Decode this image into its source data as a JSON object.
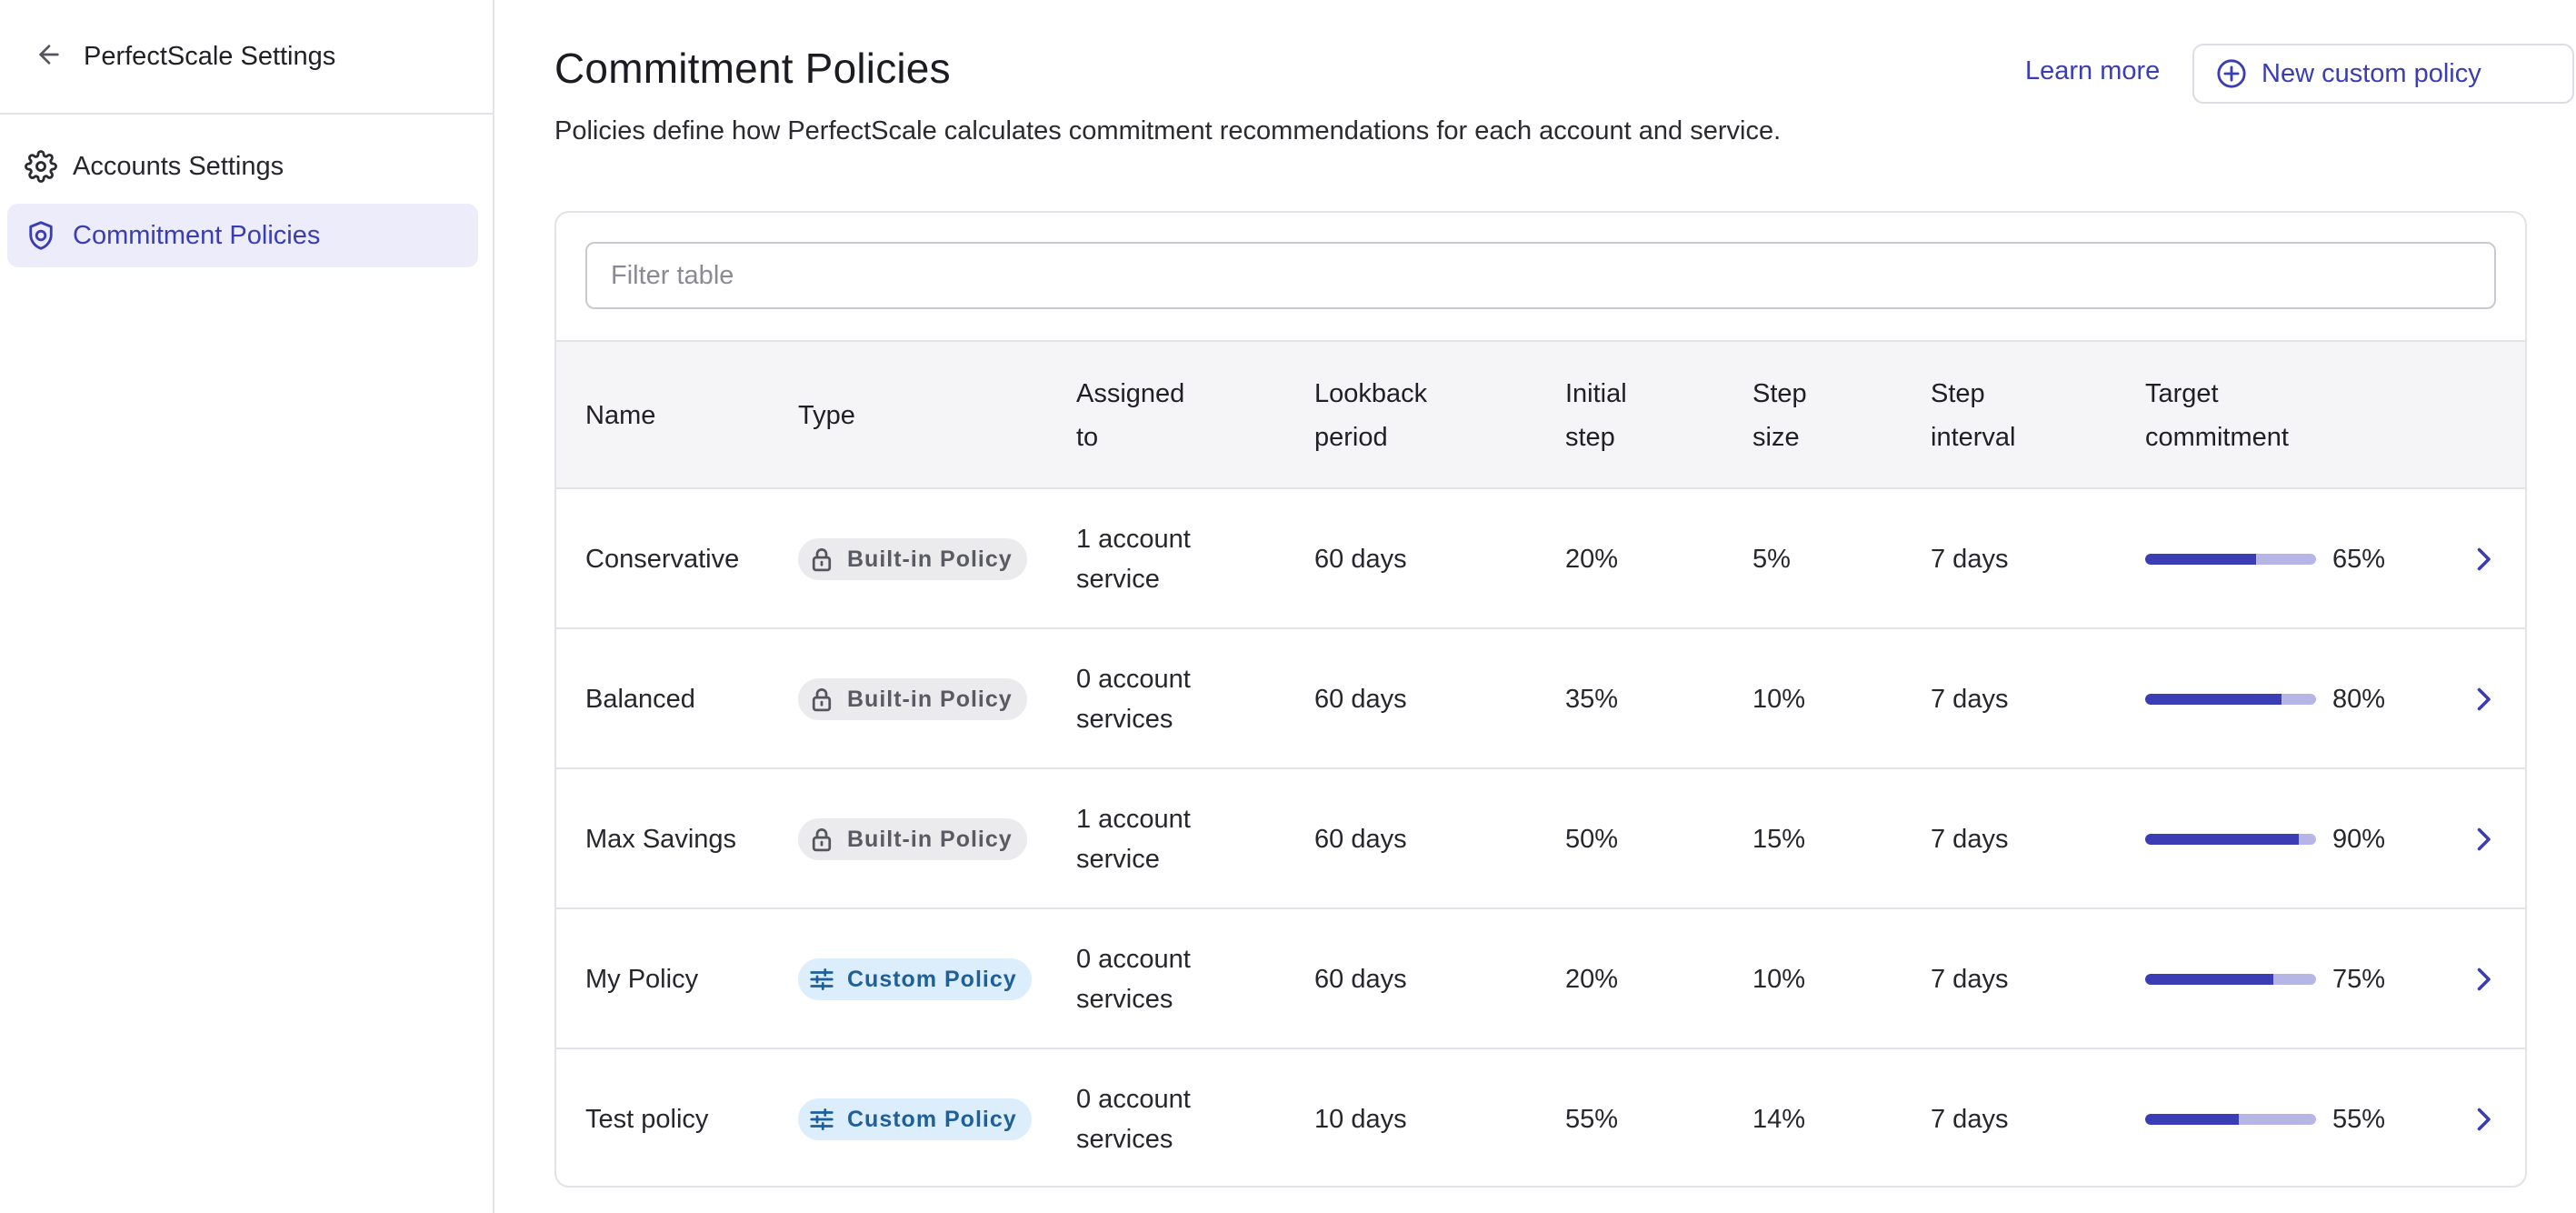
{
  "sidebar": {
    "title": "PerfectScale Settings",
    "back_icon": "arrow-left-icon",
    "items": [
      {
        "label": "Accounts Settings",
        "icon": "gear-icon",
        "active": false
      },
      {
        "label": "Commitment Policies",
        "icon": "shield-icon",
        "active": true
      }
    ]
  },
  "header": {
    "title": "Commitment Policies",
    "description": "Policies define how PerfectScale calculates commitment recommendations for each account and service.",
    "learn_more": "Learn more",
    "new_policy": "New custom policy",
    "new_policy_icon": "plus-circle-icon"
  },
  "filter": {
    "placeholder": "Filter table",
    "value": ""
  },
  "table": {
    "columns": {
      "name": "Name",
      "type": "Type",
      "assigned": "Assigned to",
      "lookback": "Lookback period",
      "initial": "Initial step",
      "stepsize": "Step size",
      "stepint": "Step interval",
      "target": "Target commitment"
    },
    "rows": [
      {
        "name": "Conservative",
        "type": "Built-in Policy",
        "type_kind": "builtin",
        "assigned": "1 account service",
        "lookback": "60 days",
        "initial": "20%",
        "stepsize": "5%",
        "stepint": "7 days",
        "target": "65%",
        "target_value": 65
      },
      {
        "name": "Balanced",
        "type": "Built-in Policy",
        "type_kind": "builtin",
        "assigned": "0 account services",
        "lookback": "60 days",
        "initial": "35%",
        "stepsize": "10%",
        "stepint": "7 days",
        "target": "80%",
        "target_value": 80
      },
      {
        "name": "Max Savings",
        "type": "Built-in Policy",
        "type_kind": "builtin",
        "assigned": "1 account service",
        "lookback": "60 days",
        "initial": "50%",
        "stepsize": "15%",
        "stepint": "7 days",
        "target": "90%",
        "target_value": 90
      },
      {
        "name": "My Policy",
        "type": "Custom Policy",
        "type_kind": "custom",
        "assigned": "0 account services",
        "lookback": "60 days",
        "initial": "20%",
        "stepsize": "10%",
        "stepint": "7 days",
        "target": "75%",
        "target_value": 75
      },
      {
        "name": "Test policy",
        "type": "Custom Policy",
        "type_kind": "custom",
        "assigned": "0 account services",
        "lookback": "10 days",
        "initial": "55%",
        "stepsize": "14%",
        "stepint": "7 days",
        "target": "55%",
        "target_value": 55
      }
    ]
  },
  "colors": {
    "accent": "#3a3db3",
    "bar_track": "#b6b6e6",
    "nav_active_bg": "#ececfa",
    "builtin_badge_bg": "#ebebee",
    "custom_badge_bg": "#dceefb"
  }
}
